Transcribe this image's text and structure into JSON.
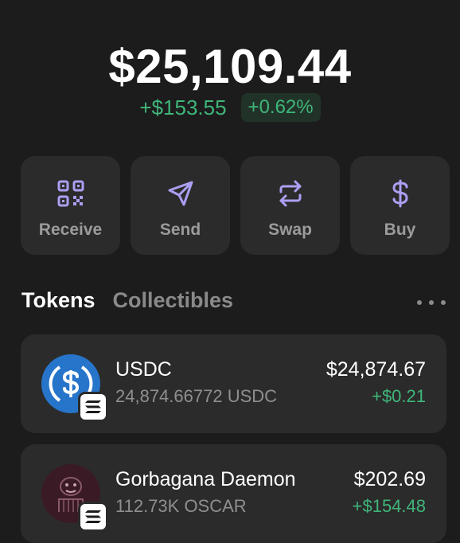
{
  "portfolio": {
    "balance": "$25,109.44",
    "change_amount": "+$153.55",
    "change_percent": "+0.62%"
  },
  "actions": [
    {
      "label": "Receive",
      "icon": "qr-code-icon"
    },
    {
      "label": "Send",
      "icon": "send-arrow-icon"
    },
    {
      "label": "Swap",
      "icon": "swap-arrows-icon"
    },
    {
      "label": "Buy",
      "icon": "dollar-icon"
    }
  ],
  "tabs": {
    "tokens": "Tokens",
    "collectibles": "Collectibles"
  },
  "tokens": [
    {
      "name": "USDC",
      "balance": "24,874.66772 USDC",
      "value": "$24,874.67",
      "change": "+$0.21",
      "icon": "usdc-logo-icon"
    },
    {
      "name": "Gorbagana Daemon",
      "balance": "112.73K OSCAR",
      "value": "$202.69",
      "change": "+$154.48",
      "icon": "oscar-token-icon"
    }
  ],
  "colors": {
    "background": "#1c1c1c",
    "card": "#2b2b2b",
    "accent_purple": "#ab9ff2",
    "positive_green": "#3fb67a",
    "usdc_blue": "#2775ca"
  }
}
